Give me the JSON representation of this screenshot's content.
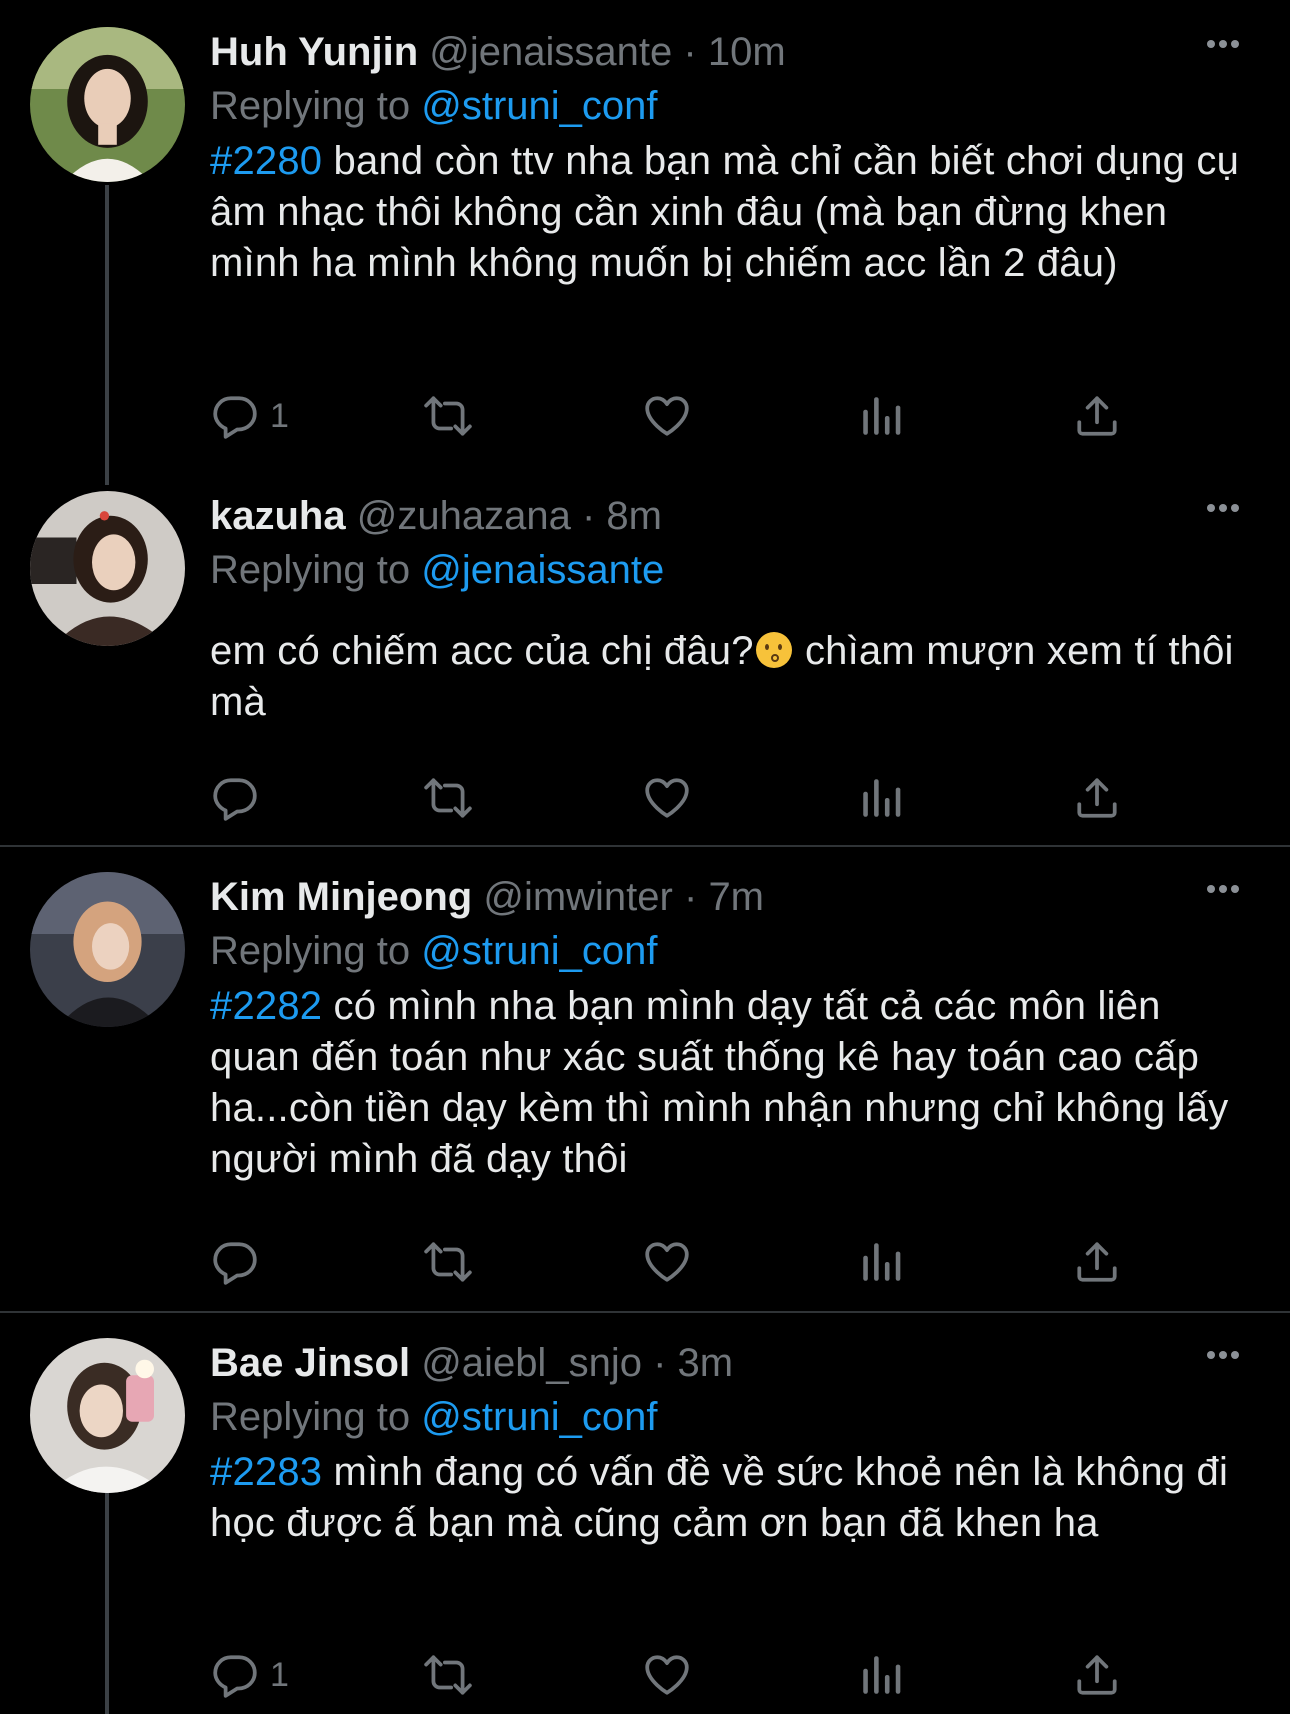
{
  "tweets": [
    {
      "name": "Huh Yunjin",
      "handle": "@jenaissante",
      "separator": "·",
      "time": "10m",
      "replying_prefix": "Replying to",
      "replying_to": "@struni_conf",
      "hashtag": "#2280",
      "text": " band còn ttv nha bạn mà chỉ cần biết chơi dụng cụ âm nhạc thôi không cần xinh đâu (mà bạn đừng khen mình ha mình không muốn bị chiếm acc lần 2 đâu)",
      "reply_count": "1"
    },
    {
      "name": "kazuha",
      "handle": "@zuhazana",
      "separator": "·",
      "time": "8m",
      "replying_prefix": "Replying to",
      "replying_to": "@jenaissante",
      "text_before_emoji": "em có chiếm acc của chị đâu?",
      "emoji": "kissing-face-emoji",
      "text_after_emoji": "  chìam mượn xem tí thôi mà",
      "reply_count": ""
    },
    {
      "name": "Kim Minjeong",
      "handle": "@imwinter",
      "separator": "·",
      "time": "7m",
      "replying_prefix": "Replying to",
      "replying_to": "@struni_conf",
      "hashtag": "#2282",
      "text": " có mình nha bạn mình dạy tất cả  các môn liên quan đến toán như xác suất thống kê hay toán cao cấp ha...còn tiền dạy kèm thì mình nhận nhưng chỉ không lấy người mình đã dạy thôi",
      "reply_count": ""
    },
    {
      "name": "Bae Jinsol",
      "handle": "@aiebl_snjo",
      "separator": "·",
      "time": "3m",
      "replying_prefix": "Replying to",
      "replying_to": "@struni_conf",
      "hashtag": "#2283",
      "text": " mình đang có vấn đề về sức khoẻ nên là không đi học được ấ bạn mà cũng cảm ơn bạn đã khen ha",
      "reply_count": "1"
    }
  ],
  "icons": [
    "reply-icon",
    "retweet-icon",
    "like-icon",
    "views-icon",
    "share-icon",
    "more-icon"
  ],
  "colors": {
    "background": "#000000",
    "text": "#e7e9ea",
    "muted": "#71767b",
    "link": "#1d9bf0",
    "divider": "#2f3336"
  }
}
